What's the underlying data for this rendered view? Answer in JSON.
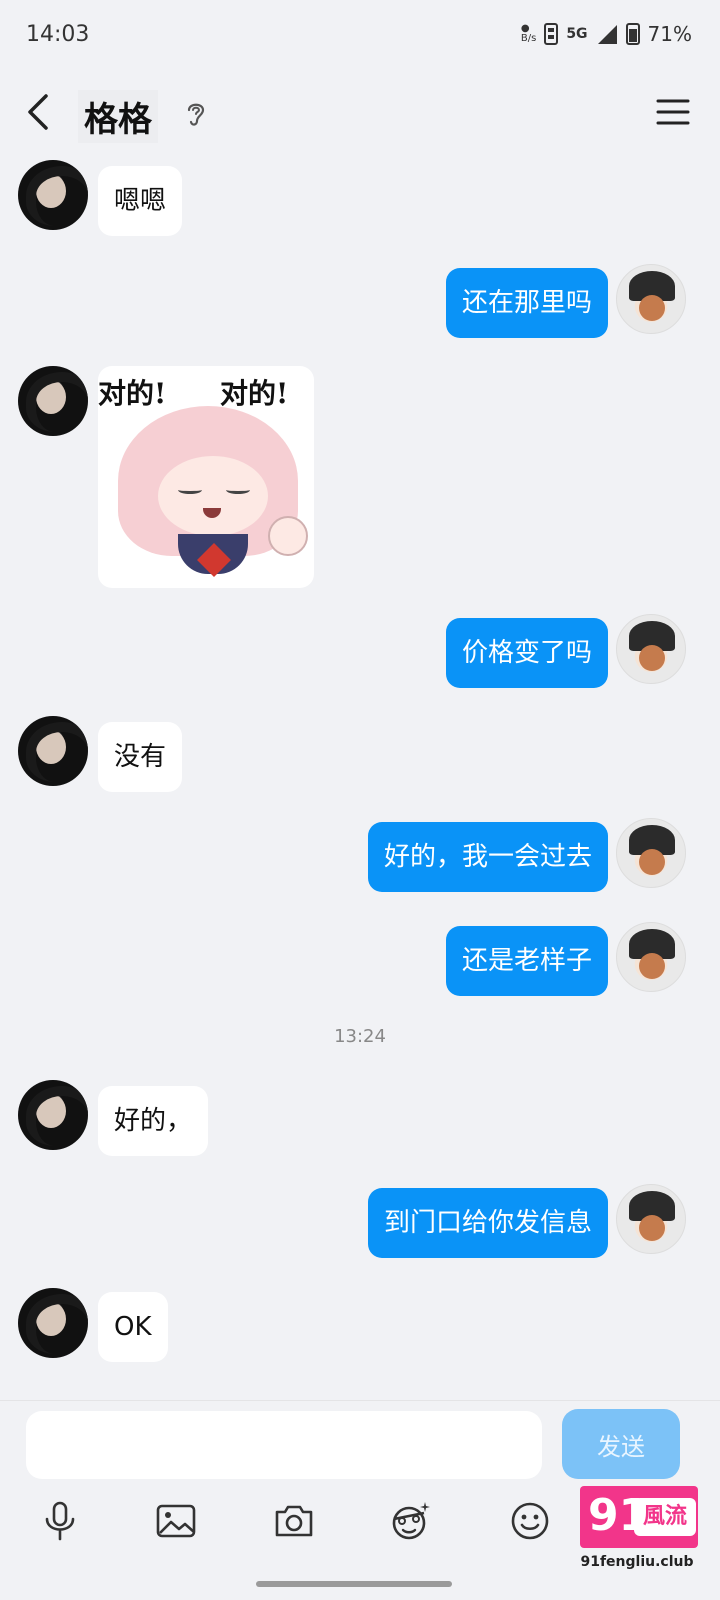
{
  "status_bar": {
    "time": "14:03",
    "net_speed": "B/s",
    "network": "5G",
    "battery": "71%"
  },
  "header": {
    "title": "格格",
    "icons": [
      "back-arrow-icon",
      "ear-icon",
      "menu-icon"
    ]
  },
  "messages": [
    {
      "side": "left",
      "type": "text",
      "text": "嗯嗯"
    },
    {
      "side": "right",
      "type": "text",
      "text": "还在那里吗"
    },
    {
      "side": "left",
      "type": "sticker",
      "sticker_text_left": "对的!",
      "sticker_text_right": "对的!"
    },
    {
      "side": "right",
      "type": "text",
      "text": "价格变了吗"
    },
    {
      "side": "left",
      "type": "text",
      "text": "没有"
    },
    {
      "side": "right",
      "type": "text",
      "text": "好的，我一会过去"
    },
    {
      "side": "right",
      "type": "text",
      "text": "还是老样子"
    },
    {
      "type": "timestamp",
      "text": "13:24"
    },
    {
      "side": "left",
      "type": "text",
      "text": "好的，"
    },
    {
      "side": "right",
      "type": "text",
      "text": "到门口给你发信息"
    },
    {
      "side": "left",
      "type": "text",
      "text": "OK"
    }
  ],
  "input": {
    "value": "",
    "send_label": "发送"
  },
  "toolbar_icons": [
    "microphone-icon",
    "image-icon",
    "camera-icon",
    "sticker-face-icon",
    "emoji-icon",
    "plus-icon"
  ],
  "watermark": {
    "number": "91",
    "label": "風流",
    "url": "91fengliu.club"
  },
  "colors": {
    "background": "#f1f2f5",
    "outgoing_bubble": "#0a93f7",
    "incoming_bubble": "#ffffff",
    "send_button": "#7cc2f7",
    "watermark": "#f2358a"
  }
}
